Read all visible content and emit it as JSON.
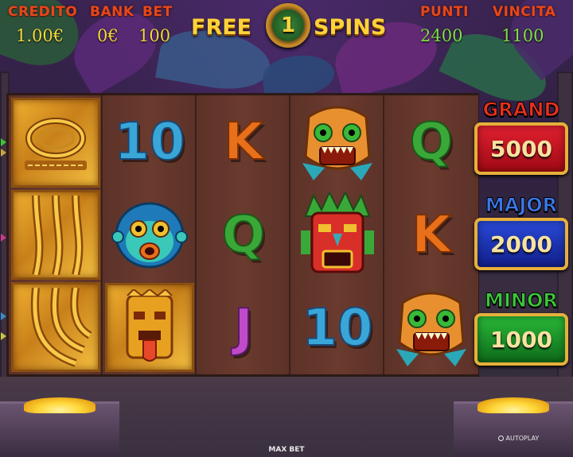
{
  "stats": {
    "credito_label": "CREDITO",
    "credito_value": "1.00€",
    "bank_label": "BANK",
    "bank_value": "0€",
    "bet_label": "BET",
    "bet_value": "100",
    "punti_label": "PUNTI",
    "punti_value": "2400",
    "vincita_label": "VINCITA",
    "vincita_value": "1100"
  },
  "free_spins": {
    "word_left": "FREE",
    "count": "1",
    "word_right": "SPINS"
  },
  "reels": [
    [
      {
        "symbol": "gold-wild-ring-icon",
        "text": ""
      },
      {
        "symbol": "gold-wild-rope-icon",
        "text": ""
      },
      {
        "symbol": "gold-wild-rope-icon",
        "text": ""
      }
    ],
    [
      {
        "symbol": "ten",
        "text": "10"
      },
      {
        "symbol": "monkey-mask-icon",
        "text": ""
      },
      {
        "symbol": "gold-tiki-mask-icon",
        "text": ""
      }
    ],
    [
      {
        "symbol": "king",
        "text": "K"
      },
      {
        "symbol": "queen",
        "text": "Q"
      },
      {
        "symbol": "jack",
        "text": "J"
      }
    ],
    [
      {
        "symbol": "jaguar-mask-icon",
        "text": ""
      },
      {
        "symbol": "tribal-mask-icon",
        "text": ""
      },
      {
        "symbol": "ten",
        "text": "10"
      }
    ],
    [
      {
        "symbol": "queen",
        "text": "Q"
      },
      {
        "symbol": "king",
        "text": "K"
      },
      {
        "symbol": "jaguar-mask-icon",
        "text": ""
      }
    ]
  ],
  "jackpots": {
    "grand_label": "GRAND",
    "grand_value": "5000",
    "major_label": "MAJOR",
    "major_value": "2000",
    "minor_label": "MINOR",
    "minor_value": "1000"
  },
  "controls": {
    "maxbet_label": "MAX BET",
    "autoplay_label": "AUTOPLAY"
  },
  "colors": {
    "stat_label": "#e8471a",
    "stat_value": "#f3d83a",
    "stat_value_green": "#7de045",
    "grand_box": "#c0121e",
    "major_box": "#1a3ab8",
    "minor_box": "#1e9a2a"
  }
}
